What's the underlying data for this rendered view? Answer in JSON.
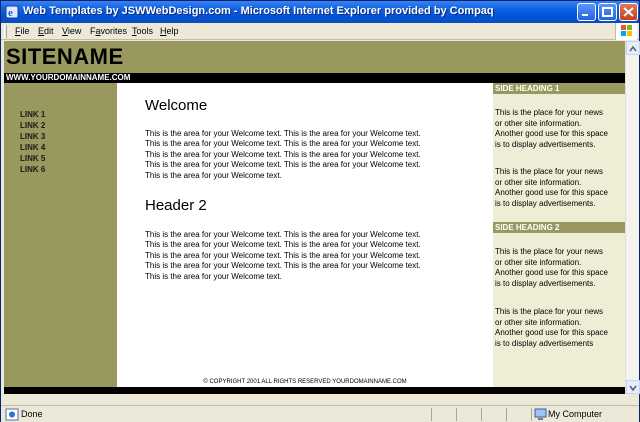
{
  "window": {
    "title": "Web Templates by JSWWebDesign.com - Microsoft Internet Explorer provided by Compaq"
  },
  "menu": {
    "items": [
      {
        "u": "F",
        "rest": "ile"
      },
      {
        "u": "E",
        "rest": "dit"
      },
      {
        "u": "V",
        "rest": "iew"
      },
      {
        "u": "",
        "pre": "F",
        "upost": "a",
        "rest": "vorites"
      },
      {
        "u": "T",
        "rest": "ools"
      },
      {
        "u": "H",
        "rest": "elp"
      }
    ]
  },
  "site": {
    "name": "SITENAME",
    "domain": "WWW.YOURDOMAINNAME.COM",
    "nav": [
      "LINK 1",
      "LINK 2",
      "LINK 3",
      "LINK 4",
      "LINK 5",
      "LINK 6"
    ],
    "main": {
      "heading1": "Welcome",
      "para1": [
        "This is the area for your Welcome text. This is the area for your Welcome text.",
        "This is the area for your Welcome text. This is the area for your Welcome text.",
        "This is the area for your Welcome text. This is the area for your Welcome text.",
        "This is the area for your Welcome text. This is the area for your Welcome text.",
        "This is the area for your Welcome text."
      ],
      "heading2": "Header 2",
      "para2": [
        "This is the area for your Welcome text. This is the area for your Welcome text.",
        "This is the area for your Welcome text. This is the area for your Welcome text.",
        "This is the area for your Welcome text. This is the area for your Welcome text.",
        "This is the area for your Welcome text. This is the area for your Welcome text.",
        "This is the area for your Welcome text."
      ]
    },
    "side": {
      "heading1": "SIDE HEADING 1",
      "text1a": [
        "This is the place for your news",
        "or other site information.",
        "Another good use for this space",
        "is to display advertisements."
      ],
      "text1b": [
        "This is the place for your news",
        "or other site information.",
        "Another good use for this space",
        "is to display advertisements."
      ],
      "heading2": "SIDE HEADING 2",
      "text2a": [
        "This is the place for your news",
        "or other site information.",
        "Another good use for this space",
        "is to display advertisements."
      ],
      "text2b": [
        "This is the place for your news",
        "or other site information.",
        "Another good use for this space",
        "is to display advertisements"
      ]
    },
    "footer": "© COPYRIGHT 2001 ALL RIGHTS RESERVED YOURDOMAINNAME.COM"
  },
  "status": {
    "text": "Done",
    "zone": "My Computer"
  },
  "colors": {
    "olive": "#99995f",
    "side_bg": "#eeeed6",
    "titlebar": "#0453d6"
  }
}
